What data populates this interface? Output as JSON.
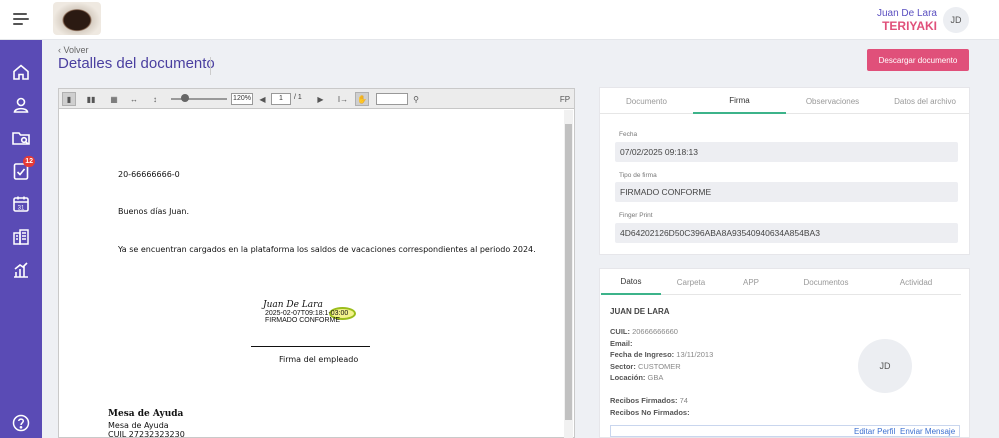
{
  "topbar": {
    "menu_icon": "hamburger-menu-icon",
    "user_name": "Juan De Lara",
    "company": "TERIYAKI",
    "avatar_initials": "JD"
  },
  "sidebar": {
    "items": [
      {
        "icon": "home-icon",
        "badge": ""
      },
      {
        "icon": "user-icon",
        "badge": ""
      },
      {
        "icon": "folder-search-icon",
        "badge": ""
      },
      {
        "icon": "task-check-icon",
        "badge": "12"
      },
      {
        "icon": "calendar-icon",
        "badge": ""
      },
      {
        "icon": "building-icon",
        "badge": ""
      },
      {
        "icon": "chart-icon",
        "badge": ""
      },
      {
        "icon": "help-icon",
        "badge": ""
      }
    ],
    "calendar_day": "31"
  },
  "header": {
    "back_label": "Volver",
    "title": "Detalles del documento",
    "download_label": "Descargar documento"
  },
  "viewer": {
    "zoom": "120%",
    "page_current": "1",
    "page_total": "/ 1",
    "document": {
      "line_id": "20-66666666-0",
      "greeting": "Buenos días Juan.",
      "body": "Ya se encuentran cargados en la plataforma los saldos de vacaciones correspondientes al periodo 2024.",
      "signature_name": "Juan De Lara",
      "signature_stamp_date": "2025-02-07T09:18:1",
      "signature_stamp_tz": "-03:00",
      "signature_type": "FIRMADO CONFORME",
      "signature_caption": "Firma del empleado",
      "company_name": "Mesa de Ayuda",
      "company_subname": "Mesa de Ayuda",
      "company_cuil": "CUIL 27232323230"
    }
  },
  "signature_panel": {
    "tabs": [
      "Documento",
      "Firma",
      "Observaciones",
      "Datos del archivo"
    ],
    "active_tab": 1,
    "fields": [
      {
        "label": "Fecha",
        "value": "07/02/2025 09:18:13"
      },
      {
        "label": "Tipo de firma",
        "value": "FIRMADO CONFORME"
      },
      {
        "label": "Finger Print",
        "value": "4D64202126D50C396ABA8A93540940634A854BA3"
      }
    ]
  },
  "employee_panel": {
    "tabs": [
      "Datos",
      "Carpeta",
      "APP",
      "Documentos",
      "Actividad"
    ],
    "active_tab": 0,
    "name": "JUAN DE LARA",
    "rows": [
      {
        "label": "CUIL:",
        "value": "20666666660"
      },
      {
        "label": "Email:",
        "value": ""
      },
      {
        "label": "Fecha de Ingreso:",
        "value": "13/11/2013"
      },
      {
        "label": "Sector:",
        "value": "CUSTOMER"
      },
      {
        "label": "Locación:",
        "value": "GBA"
      },
      {
        "label": "Recibos Firmados:",
        "value": "74"
      },
      {
        "label": "Recibos No Firmados:",
        "value": ""
      }
    ],
    "avatar_initials": "JD",
    "edit_link": "Editar Perfil",
    "message_link": "Enviar Mensaje"
  }
}
